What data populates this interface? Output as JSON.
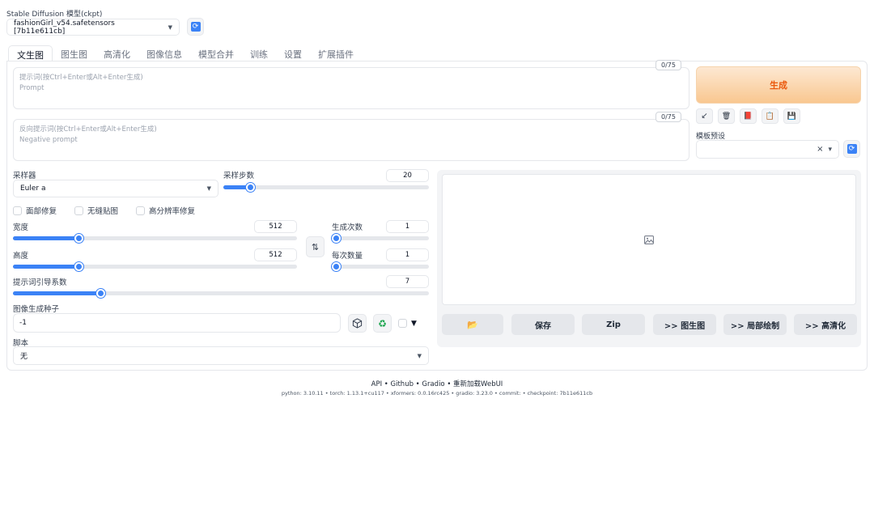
{
  "model": {
    "label": "Stable Diffusion 模型(ckpt)",
    "value": "fashionGirl_v54.safetensors [7b11e611cb]"
  },
  "tabs": [
    "文生图",
    "图生图",
    "高清化",
    "图像信息",
    "模型合并",
    "训练",
    "设置",
    "扩展插件"
  ],
  "prompt": {
    "hint": "提示词(按Ctrl+Enter或Alt+Enter生成)",
    "placeholder": "Prompt",
    "counter": "0/75"
  },
  "negative_prompt": {
    "hint": "反向提示词(按Ctrl+Enter或Alt+Enter生成)",
    "placeholder": "Negative prompt",
    "counter": "0/75"
  },
  "generate_label": "生成",
  "tools": {
    "icons": [
      "arrow-icon",
      "trash-icon",
      "book-icon",
      "clipboard-icon",
      "save-icon"
    ],
    "glyphs": [
      "↙",
      "🗑",
      "📕",
      "📋",
      "💾"
    ]
  },
  "style_preset": {
    "label": "模板预设",
    "clear": "×",
    "caret": "▾"
  },
  "sampler": {
    "label": "采样器",
    "value": "Euler a"
  },
  "steps": {
    "label": "采样步数",
    "value": "20",
    "fraction": 0.13
  },
  "checkboxes": [
    "面部修复",
    "无缝贴图",
    "高分辨率修复"
  ],
  "width": {
    "label": "宽度",
    "value": "512",
    "fraction": 0.23
  },
  "height": {
    "label": "高度",
    "value": "512",
    "fraction": 0.23
  },
  "batch_count": {
    "label": "生成次数",
    "value": "1",
    "fraction": 0.0
  },
  "batch_size": {
    "label": "每次数量",
    "value": "1",
    "fraction": 0.0
  },
  "swap_glyph": "⇅",
  "cfg": {
    "label": "提示词引导系数",
    "value": "7",
    "fraction": 0.21
  },
  "seed": {
    "label": "图像生成种子",
    "value": "-1",
    "extra_glyph": "▼"
  },
  "script": {
    "label": "脚本",
    "value": "无"
  },
  "actions": {
    "folder": "📂",
    "save": "保存",
    "zip": "Zip",
    "to_img2img": ">> 图生图",
    "to_inpaint": ">> 局部绘制",
    "to_extras": ">> 高清化"
  },
  "footer": {
    "links": "API  •  Github  •  Gradio  •  重新加载WebUI",
    "info": "python: 3.10.11  •  torch: 1.13.1+cu117  •  xformers: 0.0.16rc425  •  gradio: 3.23.0  •  commit: •  checkpoint: 7b11e611cb"
  },
  "colors": {
    "accent": "#3b82f6",
    "generate_text": "#ea580c",
    "generate_bg": "#fbd3a8"
  }
}
